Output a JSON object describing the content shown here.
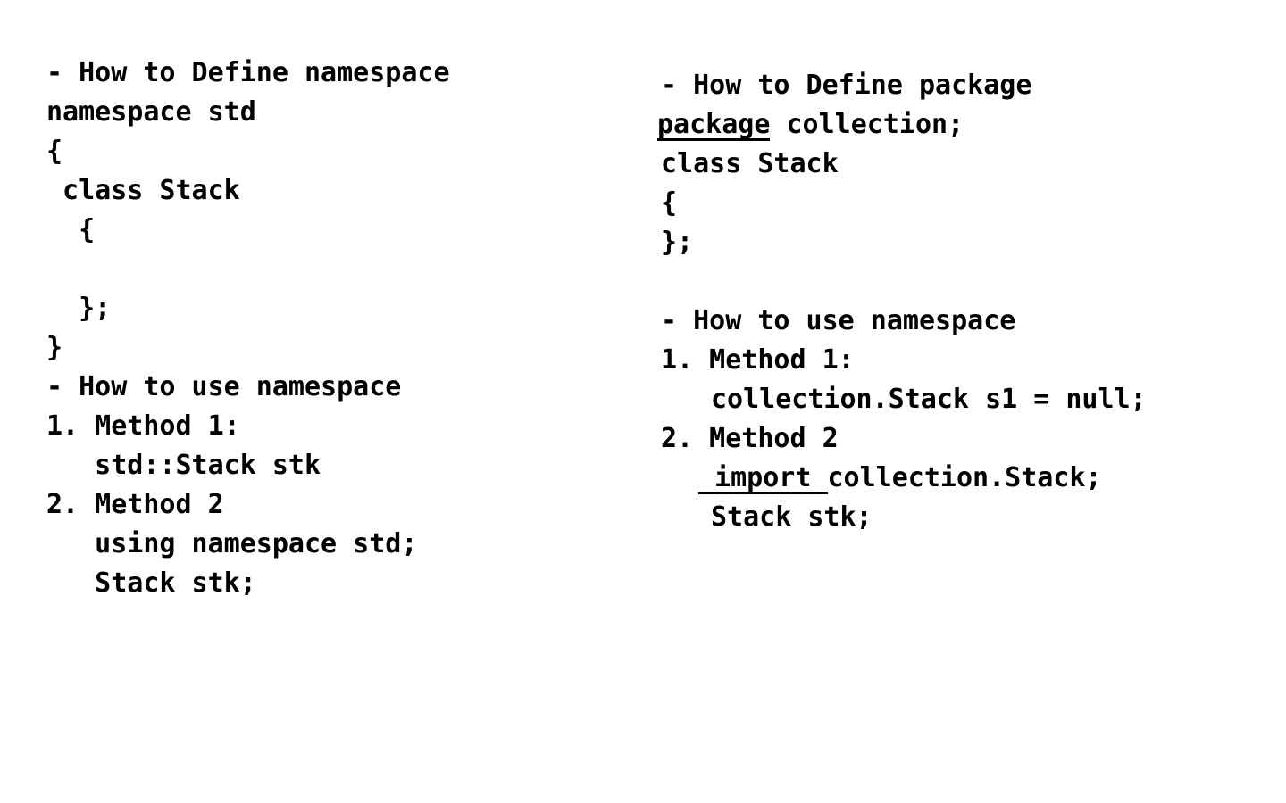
{
  "left_column": {
    "lines": [
      "- How to Define namespace",
      "namespace std",
      "{",
      " class Stack",
      "  {",
      "",
      "  };",
      "}",
      "- How to use namespace",
      "1. Method 1:",
      "   std::Stack stk",
      "2. Method 2",
      "   using namespace std;",
      "   Stack stk;"
    ]
  },
  "right_column": {
    "heading_define": "- How to Define package",
    "package_keyword": "package",
    "package_rest": " collection;",
    "class_line": "class Stack",
    "brace_open": "{",
    "brace_close": "};",
    "heading_use": "- How to use namespace",
    "method1_label": "1. Method 1:",
    "method1_code": "collection.Stack s1 = null;",
    "method2_label": "2. Method 2",
    "import_keyword": " import ",
    "import_rest": "collection.Stack;",
    "stack_decl": "Stack stk;"
  }
}
